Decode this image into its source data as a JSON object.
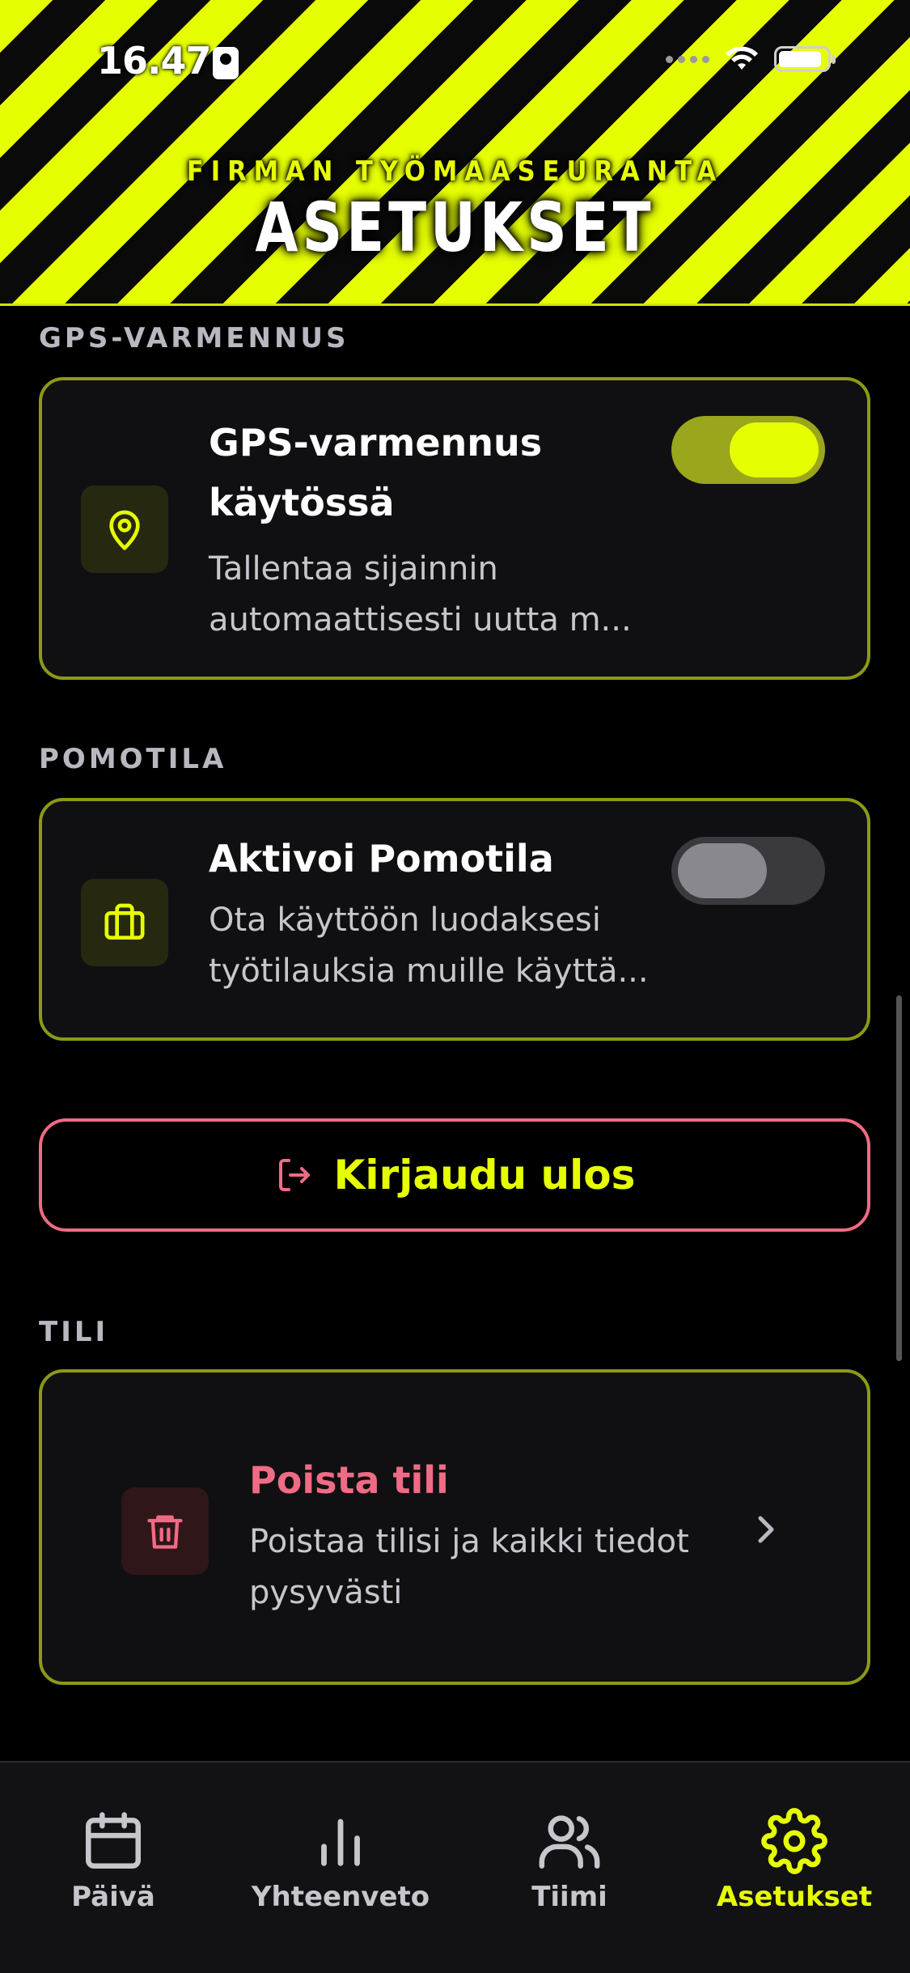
{
  "status_bar": {
    "time": "16.47"
  },
  "header": {
    "subtitle": "FIRMAN TYÖMAASEURANTA",
    "title": "ASETUKSET"
  },
  "sections": {
    "gps": {
      "label": "GPS-VARMENNUS",
      "title_line1": "GPS-varmennus",
      "title_line2": "käytössä",
      "desc_line1": "Tallentaa sijainnin",
      "desc_line2": "automaattisesti uutta m...",
      "toggle_on": true
    },
    "boss": {
      "label": "POMOTILA",
      "title": "Aktivoi Pomotila",
      "desc_line1": "Ota käyttöön luodaksesi",
      "desc_line2": "työtilauksia muille käyttä...",
      "toggle_on": false
    },
    "logout": {
      "label": "Kirjaudu ulos"
    },
    "account": {
      "label": "TILI",
      "title": "Poista tili",
      "desc_line1": "Poistaa tilisi ja kaikki tiedot",
      "desc_line2": "pysyvästi"
    }
  },
  "tabbar": {
    "tabs": [
      {
        "label": "Päivä",
        "icon": "calendar-icon"
      },
      {
        "label": "Yhteenveto",
        "icon": "bar-chart-icon"
      },
      {
        "label": "Tiimi",
        "icon": "users-icon"
      },
      {
        "label": "Asetukset",
        "icon": "gear-icon",
        "active": true
      }
    ]
  },
  "colors": {
    "accent": "#e6ff00",
    "danger": "#f06b85",
    "card_border": "#8c9a16"
  }
}
